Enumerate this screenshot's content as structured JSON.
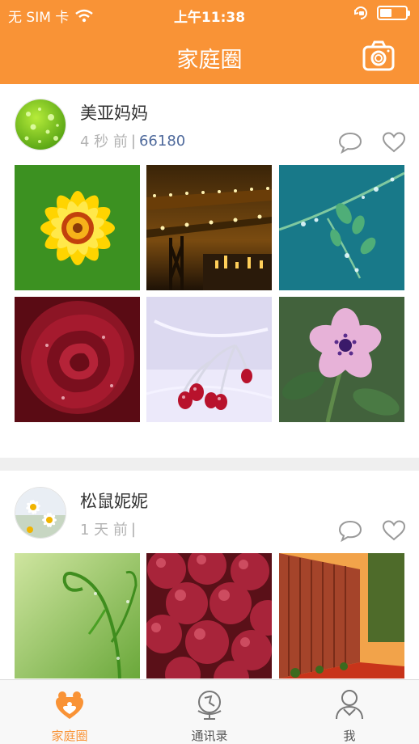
{
  "status_bar": {
    "carrier": "无 SIM 卡",
    "time": "上午11:38",
    "battery_level": 0.45,
    "icons": [
      "wifi-icon",
      "rotation-lock-icon",
      "battery-icon"
    ]
  },
  "nav": {
    "title": "家庭圈",
    "camera_icon": "camera-icon"
  },
  "colors": {
    "accent": "#F99336",
    "link_count": "#4F6A9C",
    "muted": "#B3B3B3"
  },
  "posts": [
    {
      "username": "美亚妈妈",
      "time": "4 秒 前",
      "count": "66180",
      "avatar": "water-drops-green",
      "photos": [
        "yellow-flower",
        "bridge-night",
        "dewy-branch",
        "red-rose",
        "frosted-berries",
        "pink-flower"
      ]
    },
    {
      "username": "松鼠妮妮",
      "time": "1 天 前",
      "count": "",
      "avatar": "white-daisies",
      "photos": [
        "green-tendril",
        "red-grapes",
        "autumn-fence"
      ]
    }
  ],
  "tabs": [
    {
      "label": "家庭圈",
      "icon": "family-icon",
      "active": true
    },
    {
      "label": "通讯录",
      "icon": "globe-contacts-icon",
      "active": false
    },
    {
      "label": "我",
      "icon": "person-icon",
      "active": false
    }
  ]
}
